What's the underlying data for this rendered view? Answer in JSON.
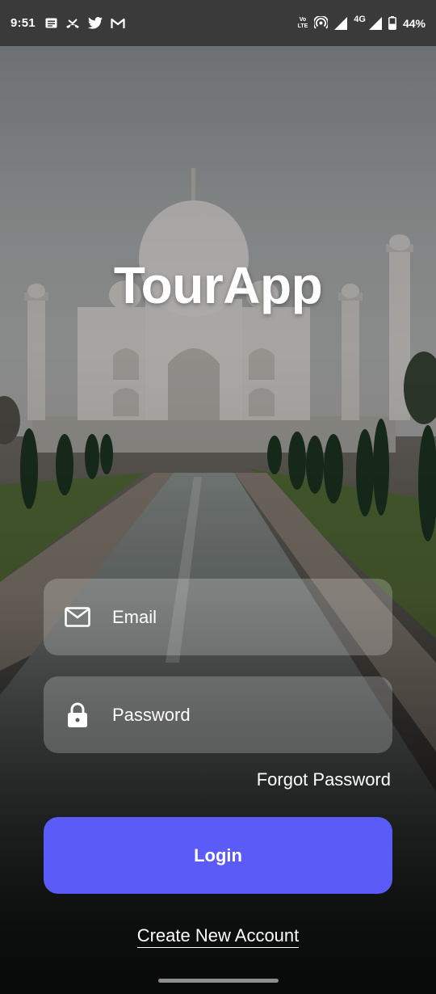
{
  "status_bar": {
    "time": "9:51",
    "left_icons": [
      "notes-icon",
      "missed-call-icon",
      "twitter-icon",
      "gmail-icon"
    ],
    "volte_top": "Vo",
    "volte_mid": "LTE",
    "network_type": "4G",
    "battery_percent": "44%"
  },
  "app": {
    "title": "TourApp",
    "background": "taj-mahal-photo"
  },
  "login_form": {
    "email": {
      "placeholder": "Email",
      "value": "",
      "icon": "mail-icon"
    },
    "password": {
      "placeholder": "Password",
      "value": "",
      "icon": "lock-icon"
    },
    "forgot_password_label": "Forgot Password",
    "login_label": "Login",
    "create_account_label": "Create New Account"
  },
  "colors": {
    "accent": "#5b5cf8",
    "field_background": "rgba(255,255,255,0.22)",
    "status_bar": "#3a3a3a",
    "text": "#ffffff"
  }
}
